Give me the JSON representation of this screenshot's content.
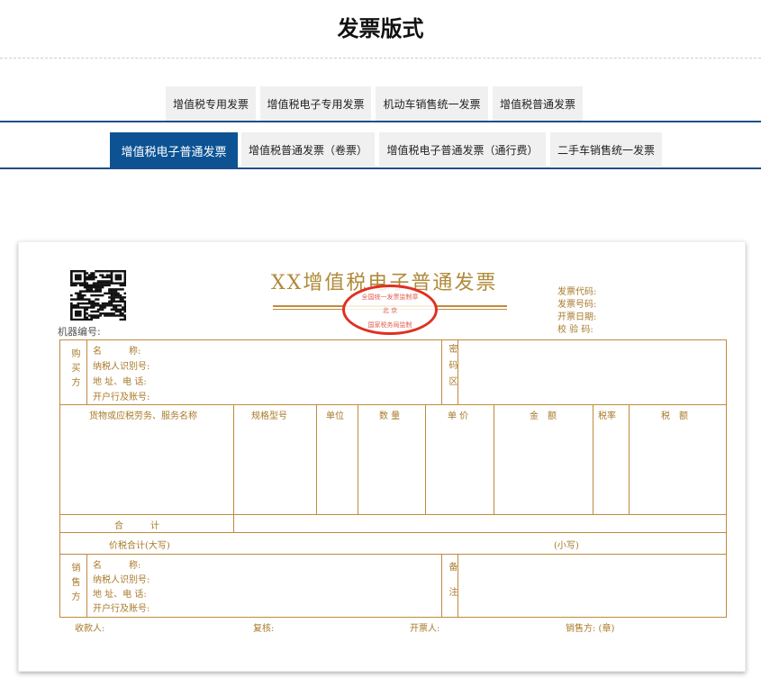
{
  "page_title": "发票版式",
  "tabs_row1": [
    "增值税专用发票",
    "增值税电子专用发票",
    "机动车销售统一发票",
    "增值税普通发票"
  ],
  "tabs_row2": [
    "增值税电子普通发票",
    "增值税普通发票（卷票）",
    "增值税电子普通发票（通行费）",
    "二手车销售统一发票"
  ],
  "invoice": {
    "title": "XX增值税电子普通发票",
    "machine_no": "机器编号:",
    "stamp": {
      "top": "全国统一发票监制章",
      "middle": "北 京",
      "bottom": "国家税务局监制"
    },
    "meta": [
      "发票代码:",
      "发票号码:",
      "开票日期:",
      "校 验 码:"
    ],
    "buyer_label": "购买方",
    "party_fields": [
      "名　　　称:",
      "纳税人识别号:",
      "地 址、电 话:",
      "开户行及账号:"
    ],
    "cipher_label": "密码区",
    "columns": [
      "货物或应税劳务、服务名称",
      "规格型号",
      "单位",
      "数 量",
      "单 价",
      "金　额",
      "税率",
      "税　额"
    ],
    "total_label": "合　　　计",
    "price_tax_total": "价税合计(大写)",
    "lowercase": "(小写)",
    "seller_label": "销售方",
    "remark_label": "备注",
    "footer": [
      "收款人:",
      "复核:",
      "开票人:",
      "销售方: (章)"
    ]
  },
  "colors": {
    "accent": "#0d5394",
    "invoice_line": "#c08a3e",
    "stamp": "#e03020"
  }
}
